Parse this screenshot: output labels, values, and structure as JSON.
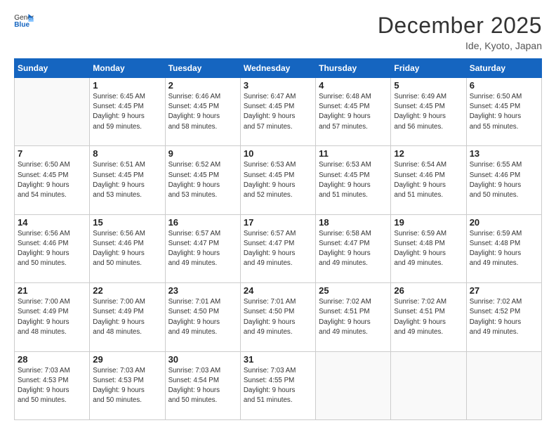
{
  "header": {
    "logo": {
      "general": "General",
      "blue": "Blue"
    },
    "title": "December 2025",
    "location": "Ide, Kyoto, Japan"
  },
  "days_of_week": [
    "Sunday",
    "Monday",
    "Tuesday",
    "Wednesday",
    "Thursday",
    "Friday",
    "Saturday"
  ],
  "weeks": [
    [
      {
        "day": "",
        "info": ""
      },
      {
        "day": "1",
        "info": "Sunrise: 6:45 AM\nSunset: 4:45 PM\nDaylight: 9 hours\nand 59 minutes."
      },
      {
        "day": "2",
        "info": "Sunrise: 6:46 AM\nSunset: 4:45 PM\nDaylight: 9 hours\nand 58 minutes."
      },
      {
        "day": "3",
        "info": "Sunrise: 6:47 AM\nSunset: 4:45 PM\nDaylight: 9 hours\nand 57 minutes."
      },
      {
        "day": "4",
        "info": "Sunrise: 6:48 AM\nSunset: 4:45 PM\nDaylight: 9 hours\nand 57 minutes."
      },
      {
        "day": "5",
        "info": "Sunrise: 6:49 AM\nSunset: 4:45 PM\nDaylight: 9 hours\nand 56 minutes."
      },
      {
        "day": "6",
        "info": "Sunrise: 6:50 AM\nSunset: 4:45 PM\nDaylight: 9 hours\nand 55 minutes."
      }
    ],
    [
      {
        "day": "7",
        "info": "Sunrise: 6:50 AM\nSunset: 4:45 PM\nDaylight: 9 hours\nand 54 minutes."
      },
      {
        "day": "8",
        "info": "Sunrise: 6:51 AM\nSunset: 4:45 PM\nDaylight: 9 hours\nand 53 minutes."
      },
      {
        "day": "9",
        "info": "Sunrise: 6:52 AM\nSunset: 4:45 PM\nDaylight: 9 hours\nand 53 minutes."
      },
      {
        "day": "10",
        "info": "Sunrise: 6:53 AM\nSunset: 4:45 PM\nDaylight: 9 hours\nand 52 minutes."
      },
      {
        "day": "11",
        "info": "Sunrise: 6:53 AM\nSunset: 4:45 PM\nDaylight: 9 hours\nand 51 minutes."
      },
      {
        "day": "12",
        "info": "Sunrise: 6:54 AM\nSunset: 4:46 PM\nDaylight: 9 hours\nand 51 minutes."
      },
      {
        "day": "13",
        "info": "Sunrise: 6:55 AM\nSunset: 4:46 PM\nDaylight: 9 hours\nand 50 minutes."
      }
    ],
    [
      {
        "day": "14",
        "info": "Sunrise: 6:56 AM\nSunset: 4:46 PM\nDaylight: 9 hours\nand 50 minutes."
      },
      {
        "day": "15",
        "info": "Sunrise: 6:56 AM\nSunset: 4:46 PM\nDaylight: 9 hours\nand 50 minutes."
      },
      {
        "day": "16",
        "info": "Sunrise: 6:57 AM\nSunset: 4:47 PM\nDaylight: 9 hours\nand 49 minutes."
      },
      {
        "day": "17",
        "info": "Sunrise: 6:57 AM\nSunset: 4:47 PM\nDaylight: 9 hours\nand 49 minutes."
      },
      {
        "day": "18",
        "info": "Sunrise: 6:58 AM\nSunset: 4:47 PM\nDaylight: 9 hours\nand 49 minutes."
      },
      {
        "day": "19",
        "info": "Sunrise: 6:59 AM\nSunset: 4:48 PM\nDaylight: 9 hours\nand 49 minutes."
      },
      {
        "day": "20",
        "info": "Sunrise: 6:59 AM\nSunset: 4:48 PM\nDaylight: 9 hours\nand 49 minutes."
      }
    ],
    [
      {
        "day": "21",
        "info": "Sunrise: 7:00 AM\nSunset: 4:49 PM\nDaylight: 9 hours\nand 48 minutes."
      },
      {
        "day": "22",
        "info": "Sunrise: 7:00 AM\nSunset: 4:49 PM\nDaylight: 9 hours\nand 48 minutes."
      },
      {
        "day": "23",
        "info": "Sunrise: 7:01 AM\nSunset: 4:50 PM\nDaylight: 9 hours\nand 49 minutes."
      },
      {
        "day": "24",
        "info": "Sunrise: 7:01 AM\nSunset: 4:50 PM\nDaylight: 9 hours\nand 49 minutes."
      },
      {
        "day": "25",
        "info": "Sunrise: 7:02 AM\nSunset: 4:51 PM\nDaylight: 9 hours\nand 49 minutes."
      },
      {
        "day": "26",
        "info": "Sunrise: 7:02 AM\nSunset: 4:51 PM\nDaylight: 9 hours\nand 49 minutes."
      },
      {
        "day": "27",
        "info": "Sunrise: 7:02 AM\nSunset: 4:52 PM\nDaylight: 9 hours\nand 49 minutes."
      }
    ],
    [
      {
        "day": "28",
        "info": "Sunrise: 7:03 AM\nSunset: 4:53 PM\nDaylight: 9 hours\nand 50 minutes."
      },
      {
        "day": "29",
        "info": "Sunrise: 7:03 AM\nSunset: 4:53 PM\nDaylight: 9 hours\nand 50 minutes."
      },
      {
        "day": "30",
        "info": "Sunrise: 7:03 AM\nSunset: 4:54 PM\nDaylight: 9 hours\nand 50 minutes."
      },
      {
        "day": "31",
        "info": "Sunrise: 7:03 AM\nSunset: 4:55 PM\nDaylight: 9 hours\nand 51 minutes."
      },
      {
        "day": "",
        "info": ""
      },
      {
        "day": "",
        "info": ""
      },
      {
        "day": "",
        "info": ""
      }
    ]
  ]
}
